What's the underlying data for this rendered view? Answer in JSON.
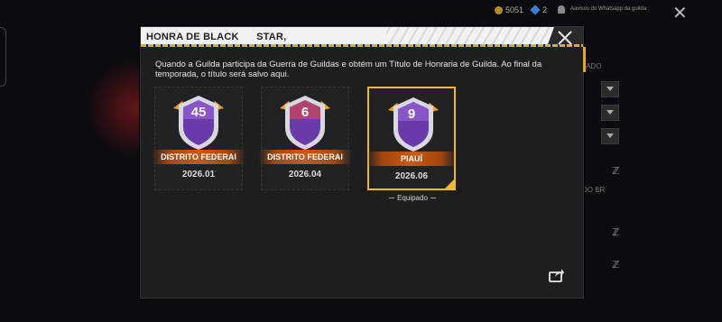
{
  "background": {
    "coins": "5051",
    "gems": "2",
    "notice": "Aavisos do Whatsapp da guilda",
    "side_labels": [
      "GADO",
      "DO BR"
    ]
  },
  "modal": {
    "title": "HONRA DE BLACK      STAR,",
    "description": "Quando a Guilda participa da Guerra de Guildas e obtém um Título de Honraria de Guilda. Ao final da temporada, o título será salvo aqui.",
    "equipped_label": "Equipado"
  },
  "titles": [
    {
      "level": "45",
      "region": "DISTRITO FEDERAI",
      "season": "2026.01"
    },
    {
      "level": "6",
      "region": "DISTRITO FEDERAI",
      "season": "2026.04"
    },
    {
      "level": "9",
      "region": "PIAUÍ",
      "season": "2026.06"
    }
  ],
  "colors": {
    "accent_gold": "#e3a92c",
    "ribbon": "#c85a12",
    "badge_purple": "#6a3aa8"
  }
}
